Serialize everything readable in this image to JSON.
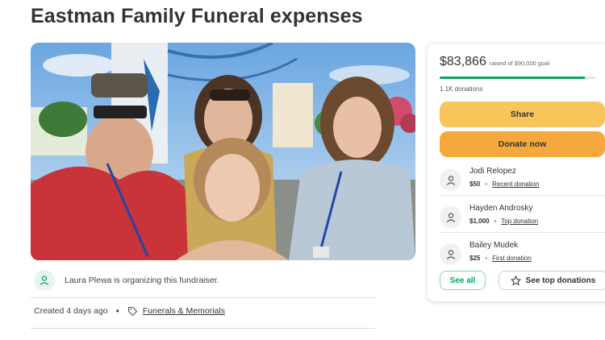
{
  "page": {
    "title": "Eastman Family Funeral expenses"
  },
  "organizer": {
    "text": "Laura Plewa is organizing this fundraiser.",
    "icon": "person-icon"
  },
  "meta": {
    "created": "Created 4 days ago",
    "separator": "•",
    "category": "Funerals & Memorials",
    "category_icon": "tag-icon"
  },
  "donation_card": {
    "raised": "$83,866",
    "goal_text": "raised of $90,000 goal",
    "progress_fraction": 0.932,
    "donations_count": "1.1K donations",
    "share_label": "Share",
    "donate_label": "Donate now",
    "donors": [
      {
        "name": "Jodi Relopez",
        "amount": "$50",
        "label": "Recent donation"
      },
      {
        "name": "Hayden Androsky",
        "amount": "$1,000",
        "label": "Top donation"
      },
      {
        "name": "Bailey Mudek",
        "amount": "$25",
        "label": "First donation"
      }
    ],
    "see_all_label": "See all",
    "see_top_label": "See top donations"
  },
  "colors": {
    "accent_green": "#02a95c",
    "share_yellow": "#f8c55a",
    "donate_orange": "#f5a93d"
  }
}
